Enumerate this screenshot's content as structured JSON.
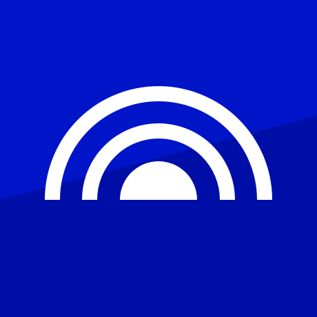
{
  "icon": {
    "semantic": "vpn-signal-arches-logo",
    "colors": {
      "background_top": "#0014c8",
      "background_bottom": "#000ea8",
      "mark": "#ffffff"
    }
  }
}
